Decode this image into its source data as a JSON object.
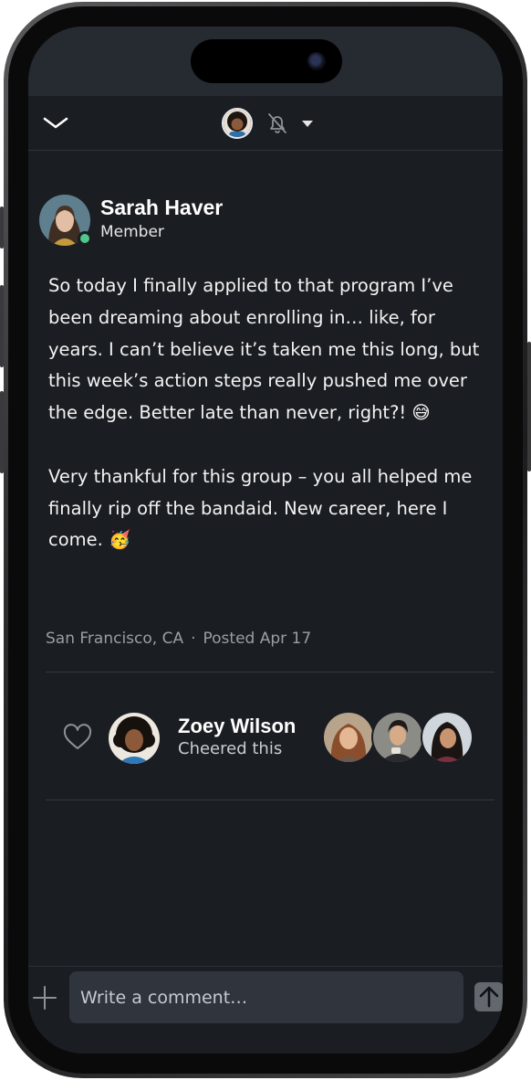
{
  "post": {
    "author_name": "Sarah Haver",
    "author_role": "Member",
    "paragraphs": [
      "So today I finally applied to that program I’ve been dreaming about enrolling in… like, for years. I can’t believe it’s taken me this long, but this week’s action steps really pushed me over the edge. Better late than never, right?! 😅",
      "Very thankful for this group – you all helped me finally rip off the bandaid. New career, here I come. 🥳"
    ],
    "location": "San Francisco, CA",
    "separator": "·",
    "posted": "Posted Apr 17"
  },
  "cheer": {
    "name": "Zoey Wilson",
    "action": "Cheered this",
    "avatar_count_shown": 3
  },
  "composer": {
    "placeholder": "Write a comment…"
  },
  "icons": {
    "back": "chevron-down-icon",
    "mute": "bell-slash-icon",
    "dropdown": "caret-down-icon",
    "cheer": "heart-outline-icon",
    "add": "plus-icon",
    "send": "arrow-up-icon"
  },
  "colors": {
    "background": "#1a1d22",
    "online": "#4fc68a",
    "input": "#30343c",
    "send": "#63676e"
  }
}
